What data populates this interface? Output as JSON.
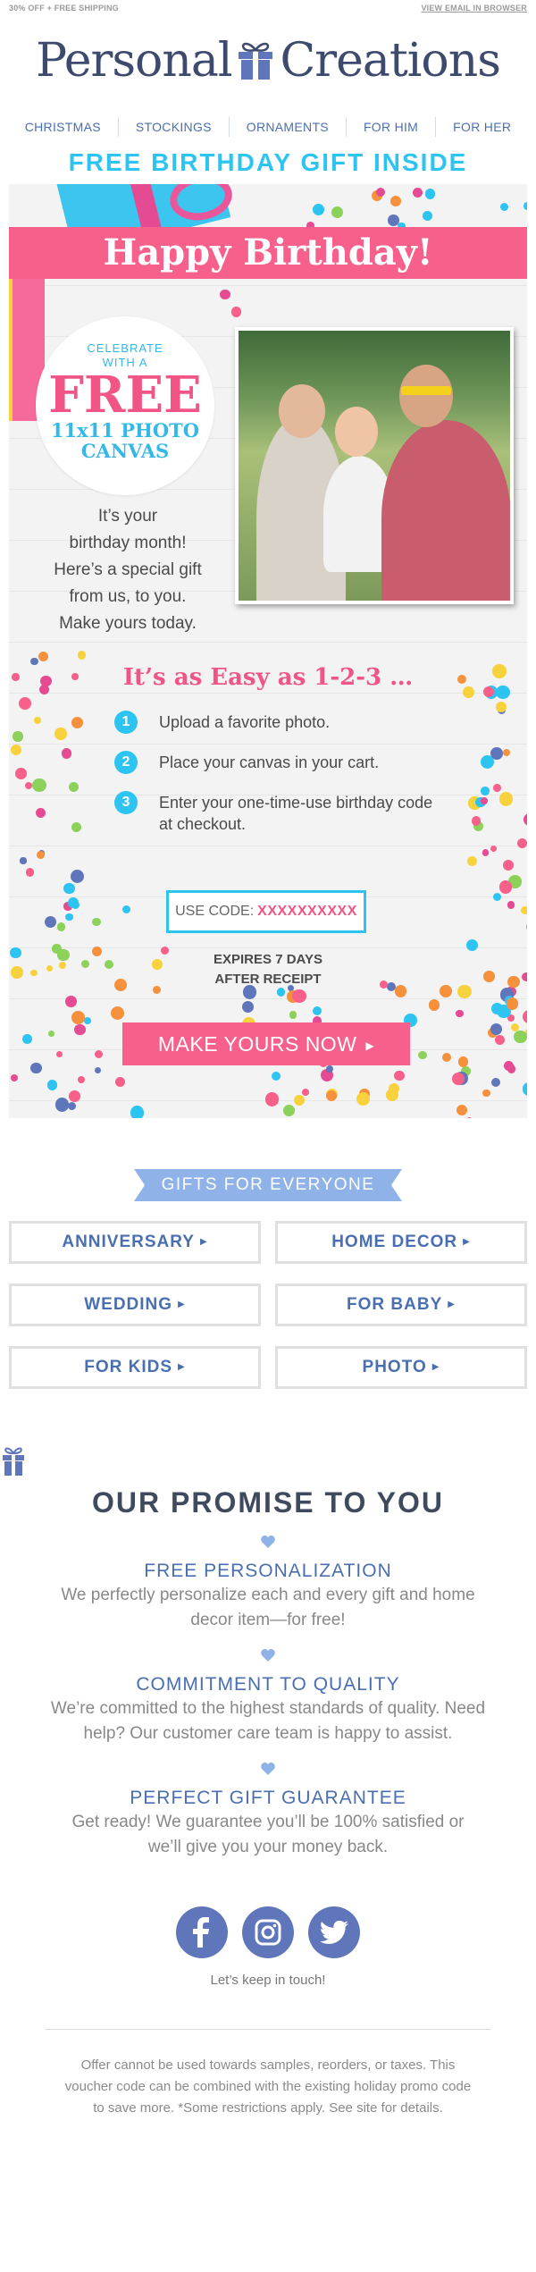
{
  "topbar": {
    "promo": "30% OFF + FREE SHIPPING",
    "view_browser": "VIEW EMAIL IN BROWSER"
  },
  "logo": {
    "left": "Personal",
    "right": "Creations"
  },
  "nav": [
    "CHRISTMAS",
    "STOCKINGS",
    "ORNAMENTS",
    "FOR HIM",
    "FOR HER"
  ],
  "headline": "FREE BIRTHDAY GIFT INSIDE",
  "hero": {
    "banner": "Happy Birthday!",
    "circle": {
      "line1": "CELEBRATE",
      "line2": "WITH A",
      "free": "FREE",
      "canvas1": "11x11 PHOTO",
      "canvas2": "CANVAS"
    },
    "message": [
      "It’s your",
      "birthday month!",
      "Here’s a special gift",
      "from us, to you.",
      "Make yours today."
    ],
    "easy_title": "It’s as Easy as 1-2-3 …",
    "steps": [
      {
        "num": "1",
        "text": "Upload a favorite photo."
      },
      {
        "num": "2",
        "text": "Place your canvas in your cart."
      },
      {
        "num": "3",
        "text": "Enter your one-time-use birthday code at checkout."
      }
    ],
    "code_label": "USE CODE:",
    "code_value": "XXXXXXXXXX",
    "expires1": "EXPIRES 7 DAYS",
    "expires2": "AFTER RECEIPT",
    "cta": "MAKE YOURS NOW"
  },
  "gifts": {
    "header": "GIFTS FOR EVERYONE",
    "items": [
      "ANNIVERSARY",
      "HOME DECOR",
      "WEDDING",
      "FOR BABY",
      "FOR KIDS",
      "PHOTO"
    ]
  },
  "promise": {
    "title": "OUR PROMISE TO YOU",
    "items": [
      {
        "title": "FREE PERSONALIZATION",
        "desc": "We perfectly personalize each and every gift and home decor item—for free!"
      },
      {
        "title": "COMMITMENT TO QUALITY",
        "desc": "We’re committed to the highest standards of quality. Need help? Our customer care team is happy to assist."
      },
      {
        "title": "PERFECT GIFT GUARANTEE",
        "desc": "Get ready! We guarantee you’ll be 100% satisfied or we’ll give you your money back."
      }
    ]
  },
  "social": {
    "icons": [
      "facebook-icon",
      "instagram-icon",
      "twitter-icon"
    ],
    "tagline": "Let’s keep in touch!"
  },
  "footer": {
    "fine_print": "Offer cannot be used towards samples, reorders, or taxes. This voucher code can be combined with the existing holiday promo code to save more. *Some restrictions apply. See site for details."
  },
  "colors": {
    "pink": "#f6608a",
    "cyan": "#2ec4f1",
    "navy": "#3d4a6e",
    "link_blue": "#4a6fb0"
  }
}
